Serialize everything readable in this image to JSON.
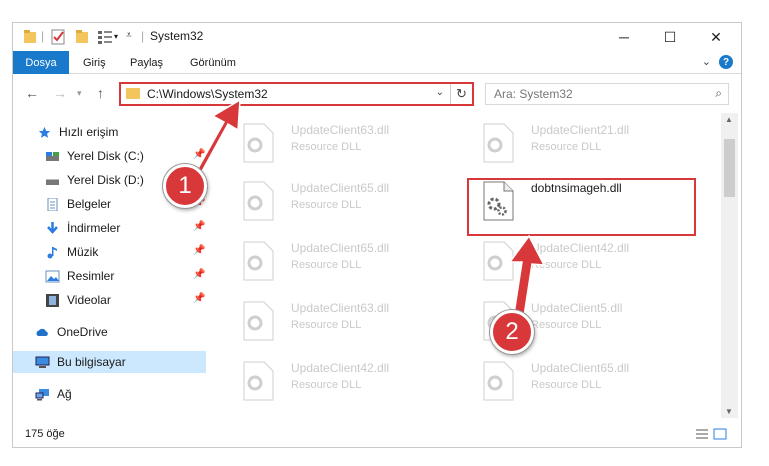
{
  "window": {
    "title": "System32",
    "minimize": "─",
    "maximize": "☐",
    "close": "✕"
  },
  "ribbon": {
    "file_tab": "Dosya",
    "tabs": [
      "Giriş",
      "Paylaş",
      "Görünüm"
    ]
  },
  "address": {
    "path": "C:\\Windows\\System32",
    "search_placeholder": "Ara: System32"
  },
  "sidebar": {
    "items": [
      {
        "label": "Hızlı erişim",
        "icon": "star-icon"
      },
      {
        "label": "Yerel Disk (C:)",
        "icon": "drive-icon",
        "pinned": true
      },
      {
        "label": "Yerel Disk (D:)",
        "icon": "drive-icon",
        "pinned": true
      },
      {
        "label": "Belgeler",
        "icon": "documents-icon",
        "pinned": true
      },
      {
        "label": "İndirmeler",
        "icon": "download-icon",
        "pinned": true
      },
      {
        "label": "Müzik",
        "icon": "music-icon",
        "pinned": true
      },
      {
        "label": "Resimler",
        "icon": "pictures-icon",
        "pinned": true
      },
      {
        "label": "Videolar",
        "icon": "videos-icon",
        "pinned": true
      },
      {
        "label": "OneDrive",
        "icon": "cloud-icon"
      },
      {
        "label": "Bu bilgisayar",
        "icon": "computer-icon",
        "selected": true
      },
      {
        "label": "Ağ",
        "icon": "network-icon"
      }
    ]
  },
  "files": {
    "left": [
      {
        "name": "UpdateClient63.dll",
        "type": "Resource DLL"
      },
      {
        "name": "UpdateClient65.dll",
        "type": "Resource DLL"
      },
      {
        "name": "UpdateClient65.dll",
        "type": "Resource DLL"
      },
      {
        "name": "UpdateClient63.dll",
        "type": "Resource DLL"
      },
      {
        "name": "UpdateClient42.dll",
        "type": "Resource DLL"
      }
    ],
    "right": [
      {
        "name": "UpdateClient21.dll",
        "type": "Resource DLL"
      },
      {
        "name": "dobtnsimageh.dll",
        "type": ""
      },
      {
        "name": "UpdateClient42.dll",
        "type": "Resource DLL"
      },
      {
        "name": "UpdateClient5.dll",
        "type": "Resource DLL"
      },
      {
        "name": "UpdateClient65.dll",
        "type": "Resource DLL"
      }
    ]
  },
  "status": {
    "count": "175 öğe"
  },
  "annotations": {
    "step1": "1",
    "step2": "2",
    "color": "#d9383a"
  }
}
